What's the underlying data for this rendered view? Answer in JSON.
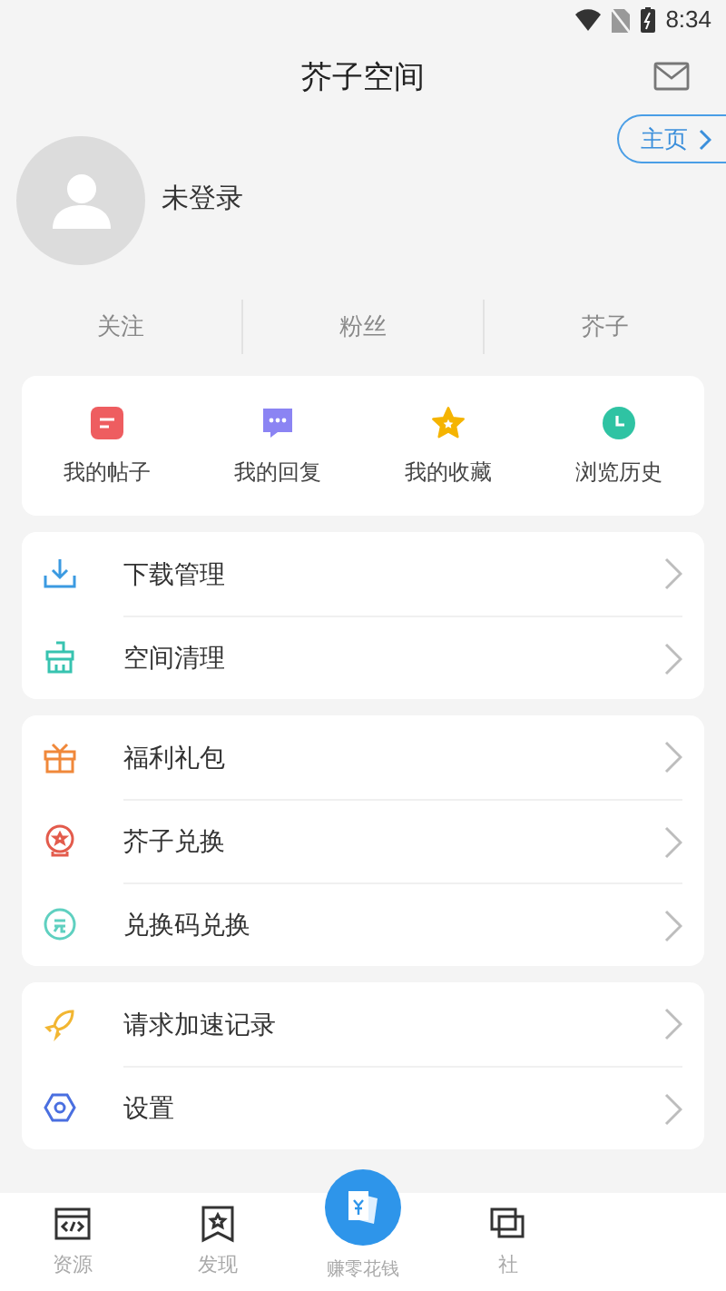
{
  "status_bar": {
    "time": "8:34"
  },
  "header": {
    "title": "芥子空间"
  },
  "profile": {
    "name": "未登录",
    "home_button": "主页"
  },
  "stats": [
    "关注",
    "粉丝",
    "芥子"
  ],
  "shortcuts": [
    {
      "label": "我的帖子",
      "kind": "posts"
    },
    {
      "label": "我的回复",
      "kind": "replies"
    },
    {
      "label": "我的收藏",
      "kind": "favorites"
    },
    {
      "label": "浏览历史",
      "kind": "history"
    }
  ],
  "menu_groups": [
    [
      {
        "label": "下载管理",
        "kind": "download"
      },
      {
        "label": "空间清理",
        "kind": "clean"
      }
    ],
    [
      {
        "label": "福利礼包",
        "kind": "gift"
      },
      {
        "label": "芥子兑换",
        "kind": "exchange"
      },
      {
        "label": "兑换码兑换",
        "kind": "code"
      }
    ],
    [
      {
        "label": "请求加速记录",
        "kind": "rocket"
      },
      {
        "label": "设置",
        "kind": "settings"
      }
    ]
  ],
  "bottom_nav": [
    {
      "label": "资源",
      "kind": "code",
      "selected": false
    },
    {
      "label": "发现",
      "kind": "discover",
      "selected": false
    },
    {
      "label": "赚零花钱",
      "kind": "earn",
      "selected": false
    },
    {
      "label": "社",
      "kind": "community",
      "selected": false
    }
  ]
}
